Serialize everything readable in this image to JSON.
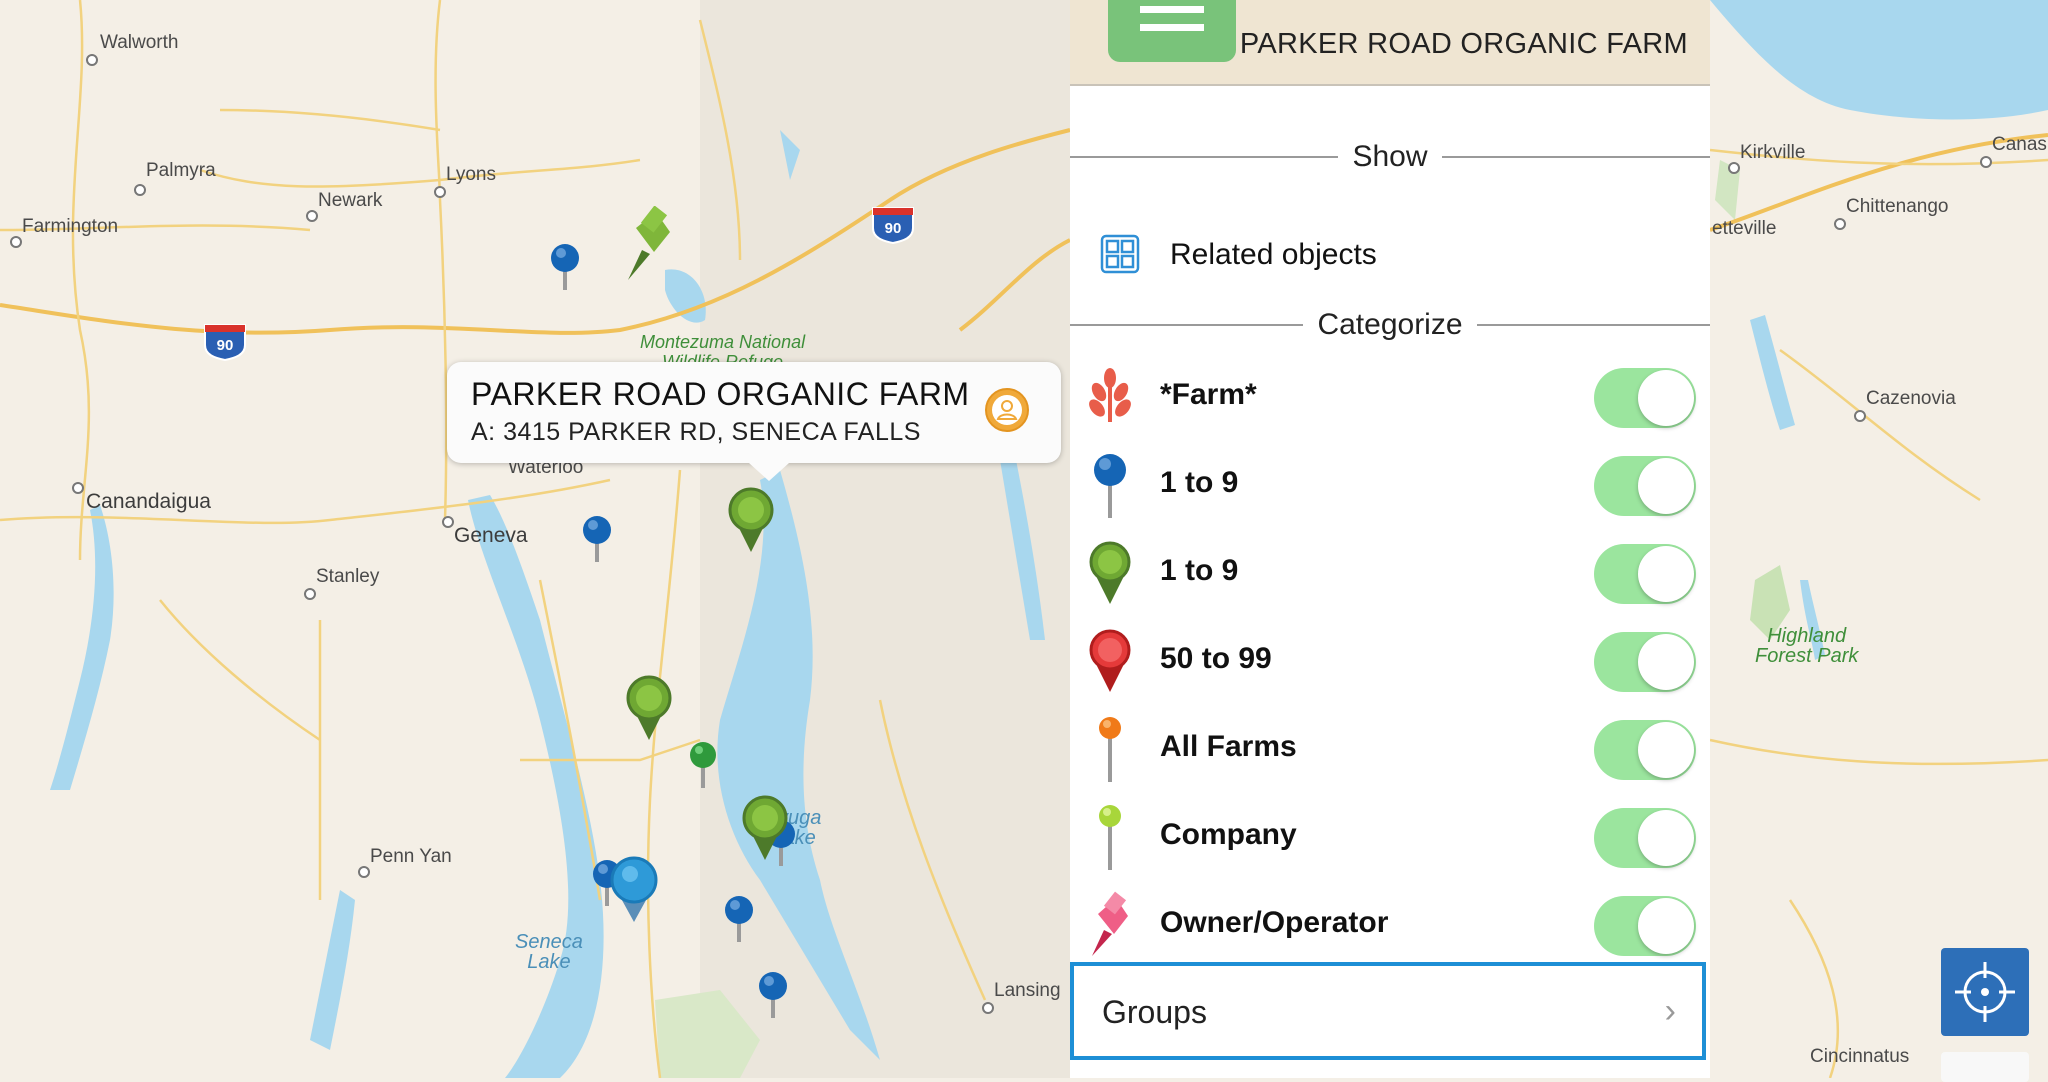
{
  "map": {
    "places": [
      {
        "id": "walworth",
        "name": "Walworth"
      },
      {
        "id": "palmyra",
        "name": "Palmyra"
      },
      {
        "id": "lyons",
        "name": "Lyons"
      },
      {
        "id": "newark",
        "name": "Newark"
      },
      {
        "id": "farmington",
        "name": "Farmington"
      },
      {
        "id": "waterloo",
        "name": "Waterloo"
      },
      {
        "id": "canandaigua",
        "name": "Canandaigua"
      },
      {
        "id": "geneva",
        "name": "Geneva"
      },
      {
        "id": "stanley",
        "name": "Stanley"
      },
      {
        "id": "pennyan",
        "name": "Penn Yan"
      },
      {
        "id": "lansing",
        "name": "Lansing"
      },
      {
        "id": "kirkville",
        "name": "Kirkville"
      },
      {
        "id": "canas",
        "name": "Canas"
      },
      {
        "id": "chittenango",
        "name": "Chittenango"
      },
      {
        "id": "etteville",
        "name": "etteville"
      },
      {
        "id": "cazenovia",
        "name": "Cazenovia"
      },
      {
        "id": "cincinnatus",
        "name": "Cincinnatus"
      }
    ],
    "water_labels": {
      "seneca_lake": "Seneca\nLake",
      "cayuga_lake": "yuga\nake"
    },
    "park_labels": {
      "montezuma": "Montezuma National\nWildlife Refuge",
      "highland": "Highland\nForest Park"
    },
    "highway_shields": [
      "90",
      "90",
      "90"
    ]
  },
  "callout": {
    "title": "PARKER ROAD ORGANIC FARM",
    "subtitle": "A: 3415 PARKER RD, SENECA FALLS",
    "icon": "person-icon"
  },
  "panel": {
    "header_title": "PARKER ROAD ORGANIC FARM",
    "header_icon": "document-icon",
    "show_label": "Show",
    "related_label": "Related objects",
    "related_icon": "grid-icon",
    "categorize_label": "Categorize",
    "categories": [
      {
        "label": "*Farm*",
        "icon": "wheat-icon",
        "enabled": true
      },
      {
        "label": "1 to 9",
        "icon": "blue-pin-icon",
        "enabled": true
      },
      {
        "label": "1 to 9",
        "icon": "green-marker-icon",
        "enabled": true
      },
      {
        "label": "50 to 99",
        "icon": "red-marker-icon",
        "enabled": true
      },
      {
        "label": "All Farms",
        "icon": "orange-pin-icon",
        "enabled": true
      },
      {
        "label": "Company",
        "icon": "lime-pin-icon",
        "enabled": true
      },
      {
        "label": "Owner/Operator",
        "icon": "pushpin-icon",
        "enabled": true
      }
    ],
    "groups_label": "Groups",
    "groups_chevron": "›"
  },
  "colors": {
    "toggle_on": "#9be59e",
    "groups_border": "#1d8fd6",
    "header_bg": "#efe5d2",
    "locate_button": "#2d6fb8"
  },
  "controls": {
    "locate_icon": "crosshair-icon"
  }
}
